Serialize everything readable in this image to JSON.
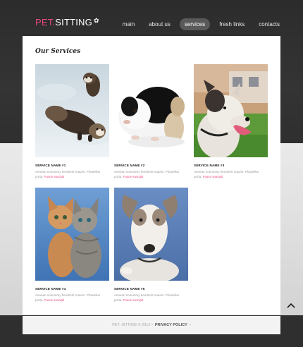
{
  "header": {
    "logo_pet": "PET.",
    "logo_sitting": "SITTING",
    "logo_mark": "✿"
  },
  "nav": {
    "items": [
      "main",
      "about us",
      "services",
      "fresh links",
      "contacts"
    ],
    "active": "services"
  },
  "services": {
    "title": "Our Services",
    "items": [
      {
        "title": "SERVICE NAME #1",
        "text": "Aenean nonummy hendrerit mauris. Phasellus porta.",
        "more": "Fusce suscipit"
      },
      {
        "title": "SERVICE NAME #2",
        "text": "Aenean nonummy hendrerit mauris. Phasellus porta.",
        "more": "Fusce suscipit"
      },
      {
        "title": "SERVICE NAME #3",
        "text": "Aenean nonummy hendrerit mauris. Phasellus porta.",
        "more": "Fusce suscipit"
      },
      {
        "title": "SERVICE NAME #4",
        "text": "Aenean nonummy hendrerit mauris. Phasellus porta.",
        "more": "Fusce suscipit"
      },
      {
        "title": "SERVICE NAME #5",
        "text": "Aenean nonummy hendrerit mauris. Phasellus porta.",
        "more": "Fusce suscipit"
      }
    ]
  },
  "footer": {
    "copyright": "PET. SITTING © 2012 •",
    "policy": "PRIVACY POLICY",
    "dot": "•"
  },
  "colors": {
    "accent": "#e9467f",
    "header_bg": "#2f2f2f",
    "nav_active_bg": "#595959"
  }
}
